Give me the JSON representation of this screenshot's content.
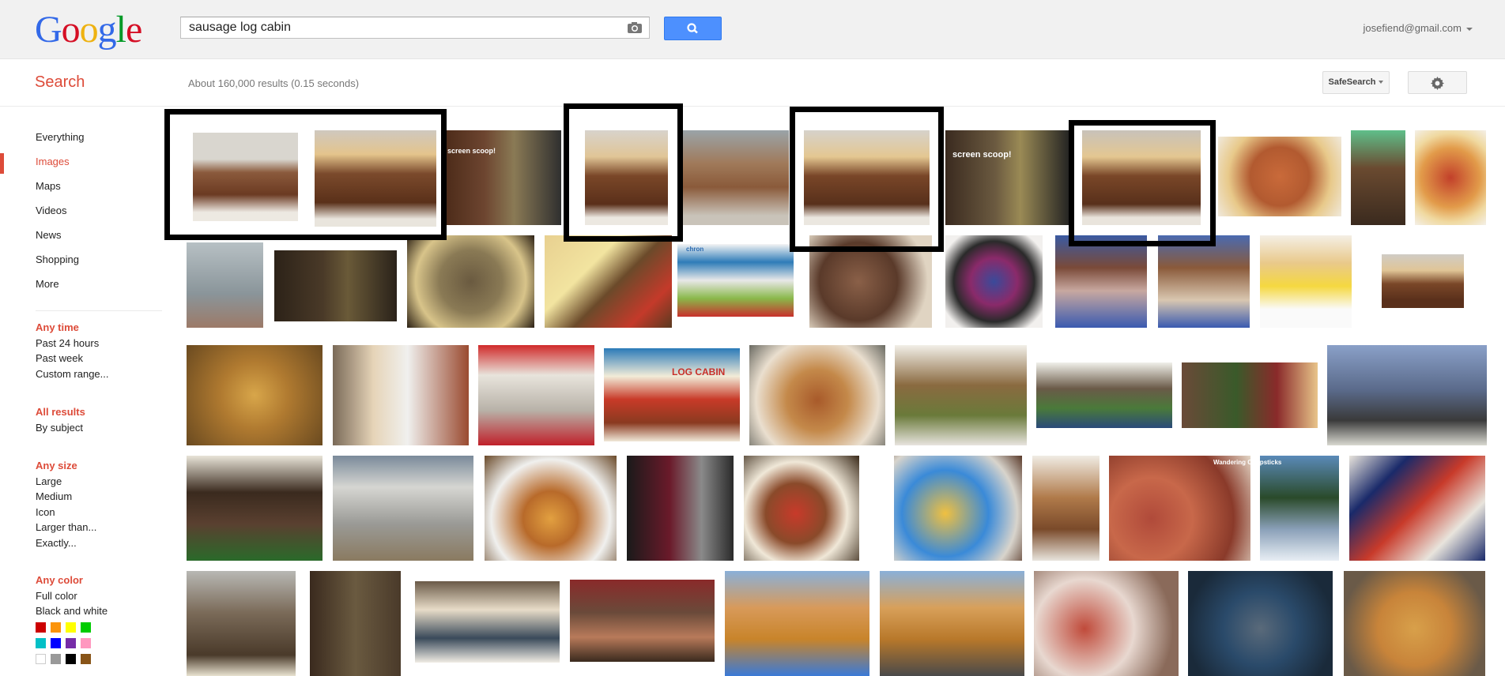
{
  "header": {
    "logo_letters": [
      {
        "ch": "G",
        "color": "#3369e8"
      },
      {
        "ch": "o",
        "color": "#d50f25"
      },
      {
        "ch": "o",
        "color": "#eeb211"
      },
      {
        "ch": "g",
        "color": "#3369e8"
      },
      {
        "ch": "l",
        "color": "#009925"
      },
      {
        "ch": "e",
        "color": "#d50f25"
      }
    ],
    "search_query": "sausage log cabin",
    "account_email": "josefiend@gmail.com"
  },
  "subbar": {
    "title": "Search",
    "result_stats": "About 160,000 results (0.15 seconds)",
    "safesearch_label": "SafeSearch"
  },
  "nav": {
    "items": [
      "Everything",
      "Images",
      "Maps",
      "Videos",
      "News",
      "Shopping",
      "More"
    ],
    "active": "Images"
  },
  "filters": {
    "time": {
      "head": "Any time",
      "options": [
        "Past 24 hours",
        "Past week",
        "Custom range..."
      ]
    },
    "results": {
      "head": "All results",
      "options": [
        "By subject"
      ]
    },
    "size": {
      "head": "Any size",
      "options": [
        "Large",
        "Medium",
        "Icon",
        "Larger than...",
        "Exactly..."
      ]
    },
    "color": {
      "head": "Any color",
      "options": [
        "Full color",
        "Black and white"
      ]
    }
  },
  "color_swatches": [
    "#cc0000",
    "#fb940b",
    "#ffff00",
    "#00cc00",
    "#03c0c6",
    "#0000ff",
    "#762ca7",
    "#ff98bf",
    "#ffffff",
    "#999999",
    "#000000",
    "#885418"
  ],
  "captions": {
    "screen_scoop": "screen scoop!",
    "wandering": "Wandering Chopsticks",
    "log_cabin": "LOG CABIN",
    "chron": "chron"
  },
  "icons": {
    "camera": "camera-icon",
    "search": "search-icon",
    "settings": "gear-icon"
  }
}
